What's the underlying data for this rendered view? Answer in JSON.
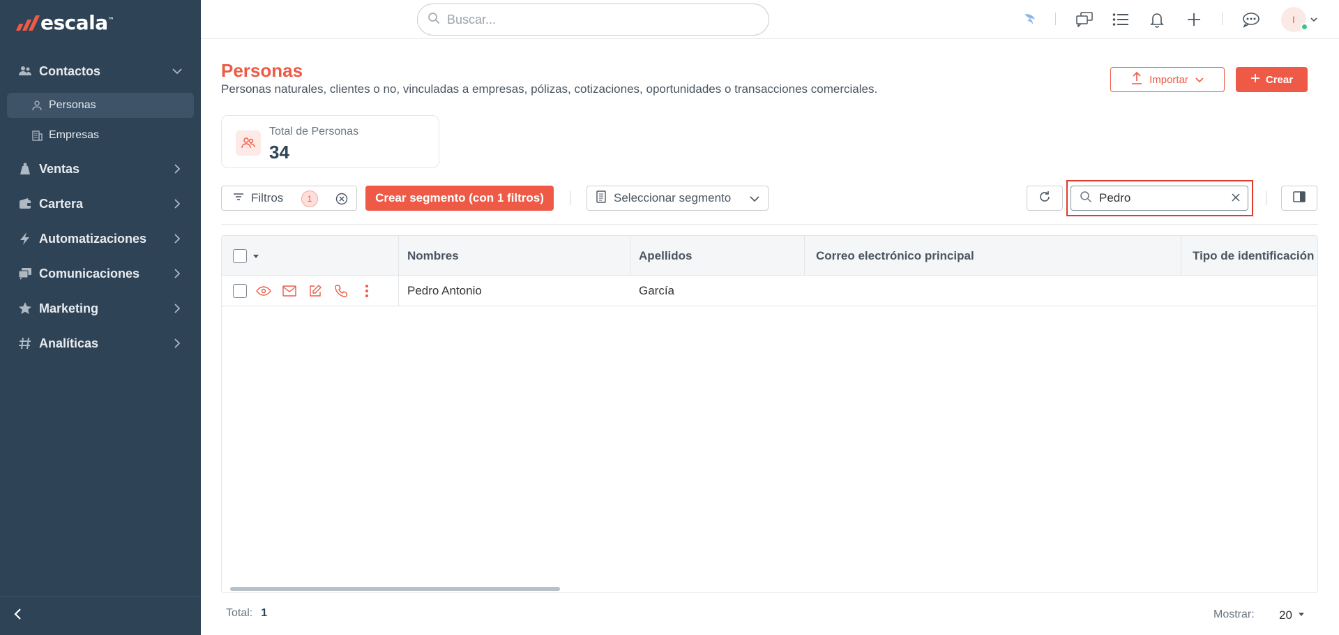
{
  "app": {
    "logo": "escala",
    "logo_tm": "™"
  },
  "search": {
    "placeholder": "Buscar..."
  },
  "sidebar": {
    "sections": [
      {
        "label": "Contactos",
        "icon": "contacts-icon"
      },
      {
        "label": "Ventas",
        "icon": "sales-icon"
      },
      {
        "label": "Cartera",
        "icon": "wallet-icon"
      },
      {
        "label": "Automatizaciones",
        "icon": "lightning-icon"
      },
      {
        "label": "Comunicaciones",
        "icon": "chat-icon"
      },
      {
        "label": "Marketing",
        "icon": "star-icon"
      },
      {
        "label": "Analíticas",
        "icon": "hash-icon"
      }
    ],
    "sub_items": [
      {
        "label": "Personas",
        "icon": "person-icon",
        "active": true
      },
      {
        "label": "Empresas",
        "icon": "building-icon",
        "active": false
      }
    ]
  },
  "user": {
    "initial": "I"
  },
  "page": {
    "title": "Personas",
    "description": "Personas naturales, clientes o no, vinculadas a empresas, pólizas, cotizaciones, oportunidades o transacciones comerciales.",
    "import_label": "Importar",
    "create_label": "Crear",
    "stat_label": "Total de Personas",
    "stat_value": "34"
  },
  "toolbar": {
    "filters_label": "Filtros",
    "filters_count": "1",
    "create_segment_label": "Crear segmento (con 1 filtros)",
    "select_segment_label": "Seleccionar segmento",
    "table_search_value": "Pedro"
  },
  "table": {
    "columns": [
      "Nombres",
      "Apellidos",
      "Correo electrónico principal",
      "Tipo de identificación"
    ],
    "rows": [
      {
        "nombres": "Pedro Antonio",
        "apellidos": "García",
        "correo": "",
        "tipo_id": ""
      }
    ]
  },
  "footer": {
    "total_label": "Total:",
    "total_value": "1",
    "show_label": "Mostrar:",
    "show_value": "20"
  },
  "colors": {
    "brand": "#ee5a45",
    "sidebar": "#2f4356",
    "highlight": "#e03a2e"
  }
}
